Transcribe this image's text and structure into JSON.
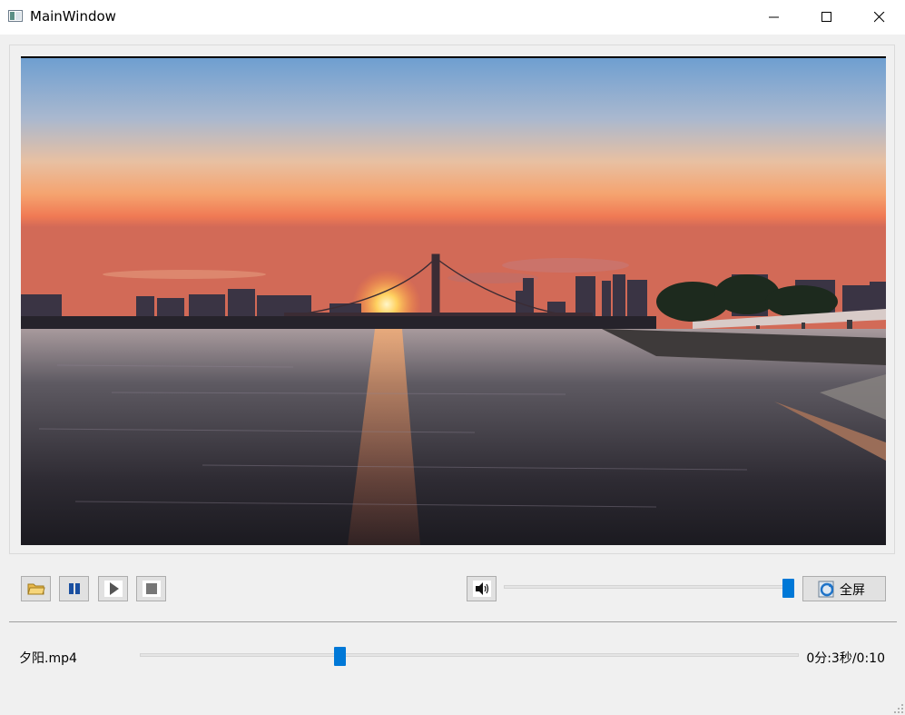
{
  "window": {
    "title": "MainWindow",
    "icon": "app-window-icon"
  },
  "titlebar_buttons": {
    "minimize_icon": "minimize-icon",
    "maximize_icon": "maximize-icon",
    "close_icon": "close-icon"
  },
  "video": {
    "scene": "sunset over river with suspension bridge and city skyline"
  },
  "controls": {
    "open_icon": "folder-open-icon",
    "pause_icon": "pause-icon",
    "play_icon": "play-icon",
    "stop_icon": "stop-icon",
    "volume_icon": "speaker-volume-icon",
    "volume_level": 1.0,
    "fullscreen_label": "全屏",
    "fullscreen_icon": "fullscreen-refresh-icon"
  },
  "playback": {
    "filename": "夕阳.mp4",
    "time_text": "0分:3秒/0:10",
    "progress": 0.3
  },
  "colors": {
    "accent": "#0078d7",
    "background": "#f0f0f0",
    "button_face": "#e1e1e1"
  }
}
